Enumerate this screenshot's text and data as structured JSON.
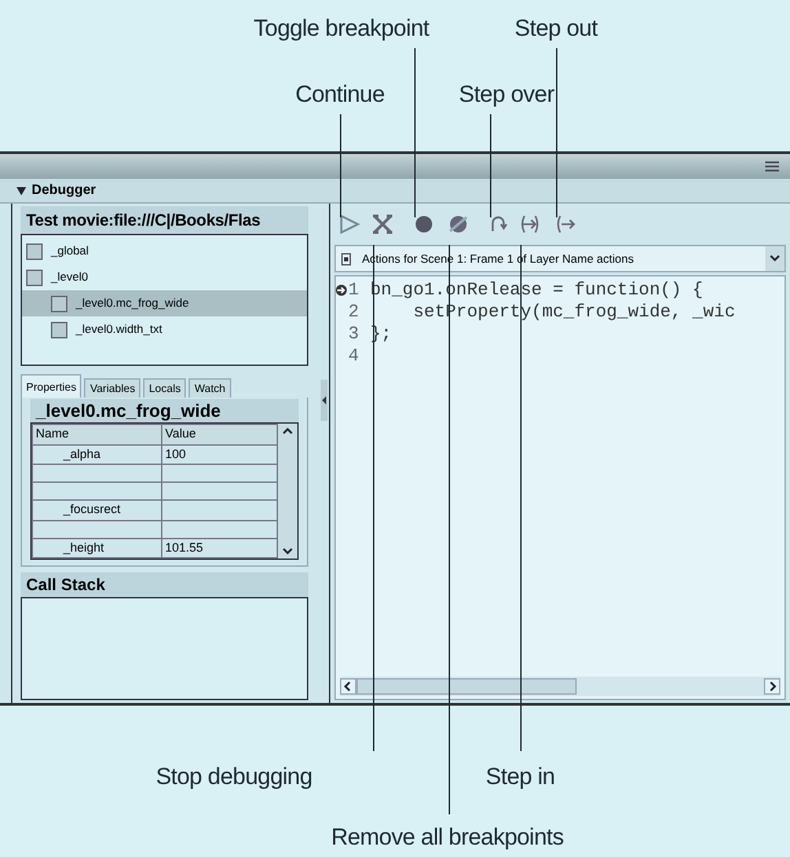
{
  "callouts": [
    {
      "label": "Toggle breakpoint"
    },
    {
      "label": "Step out"
    },
    {
      "label": "Continue"
    },
    {
      "label": "Step over"
    },
    {
      "label": "Stop debugging"
    },
    {
      "label": "Step in"
    },
    {
      "label": "Remove all breakpoints"
    }
  ],
  "debugger": {
    "title": "Debugger",
    "movie": "Test movie:file:///C|/Books/Flas",
    "tree": [
      {
        "label": "_global",
        "selected": false
      },
      {
        "label": "_level0",
        "selected": false,
        "children": [
          {
            "label": "_level0.mc_frog_wide",
            "selected": true
          },
          {
            "label": "_level0.width_txt",
            "selected": false
          }
        ]
      }
    ],
    "tabs": [
      {
        "label": "Properties",
        "selected": true
      },
      {
        "label": "Variables",
        "selected": false
      },
      {
        "label": "Locals",
        "selected": false
      },
      {
        "label": "Watch",
        "selected": false
      }
    ],
    "object_name": "_level0.mc_frog_wide",
    "properties": {
      "columns": [
        "Name",
        "Value"
      ],
      "rows": [
        [
          "_alpha",
          "100"
        ],
        [
          "",
          ""
        ],
        [
          "",
          ""
        ],
        [
          "_focusrect",
          ""
        ],
        [
          "",
          ""
        ],
        [
          "_height",
          "101.55"
        ]
      ]
    },
    "call_stack": {
      "title": "Call Stack"
    },
    "script_selector": "Actions for Scene 1: Frame 1 of Layer Name actions",
    "code": [
      {
        "number": "1",
        "text": "bn_go1.onRelease = function() {",
        "current": true
      },
      {
        "number": "2",
        "text": "    setProperty(mc_frog_wide, _wic",
        "current": false
      },
      {
        "number": "3",
        "text": "};",
        "current": false
      },
      {
        "number": "4",
        "current": false
      }
    ]
  }
}
